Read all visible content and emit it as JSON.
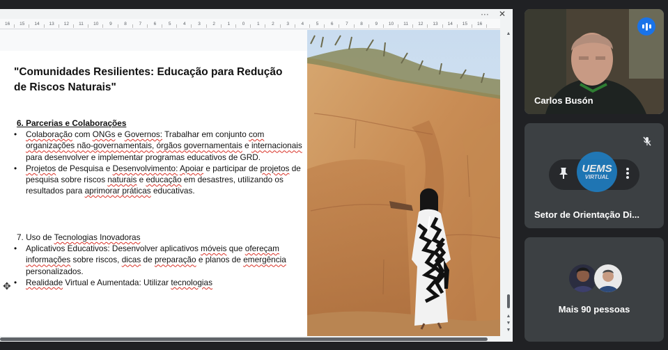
{
  "window": {
    "more_label": "···",
    "close_label": "✕"
  },
  "ruler": {
    "ticks": [
      "16",
      "15",
      "14",
      "13",
      "12",
      "11",
      "10",
      "9",
      "8",
      "7",
      "6",
      "5",
      "4",
      "3",
      "2",
      "1",
      "0",
      "1",
      "2",
      "3",
      "4",
      "5",
      "6",
      "7",
      "8",
      "9",
      "10",
      "11",
      "12",
      "13",
      "14",
      "15",
      "16"
    ]
  },
  "document": {
    "title": "\"Comunidades Resilientes: Educação para Redução de Riscos Naturais\"",
    "section6": {
      "heading": "6. Parcerias e Colaborações",
      "bullets": [
        [
          {
            "t": "Colaboração",
            "sq": true
          },
          {
            "t": " com "
          },
          {
            "t": "ONGs",
            "sq": true
          },
          {
            "t": " e "
          },
          {
            "t": "Governos:",
            "sq": true
          },
          {
            "t": " Trabalhar em conjunto "
          },
          {
            "t": "com organizações não-governamentais,",
            "sq": true
          },
          {
            "t": " "
          },
          {
            "t": "órgãos governamentais",
            "sq": true
          },
          {
            "t": " e "
          },
          {
            "t": "internacionais",
            "sq": true
          },
          {
            "t": " para desenvolver e implementar programas educativos de GRD."
          }
        ],
        [
          {
            "t": "Projetos",
            "sq": true
          },
          {
            "t": " de Pesquisa e "
          },
          {
            "t": "Desenvolvimento:",
            "sq": true
          },
          {
            "t": " "
          },
          {
            "t": "Apoiar",
            "sq": true
          },
          {
            "t": " e participar de "
          },
          {
            "t": "projetos",
            "sq": true
          },
          {
            "t": " de pesquisa sobre riscos "
          },
          {
            "t": "naturais",
            "sq": true
          },
          {
            "t": " e "
          },
          {
            "t": "educação",
            "sq": true
          },
          {
            "t": " em desastres, utilizando os resultados para "
          },
          {
            "t": "aprimorar práticas",
            "sq": true
          },
          {
            "t": " educativas."
          }
        ]
      ]
    },
    "section7": {
      "heading_parts": [
        {
          "t": "7. Uso de "
        },
        {
          "t": "Tecnologias Inovadoras",
          "sq": true
        }
      ],
      "bullets": [
        [
          {
            "t": "Aplicativos Educativos: Desenvolver aplicativos "
          },
          {
            "t": "móveis",
            "sq": true
          },
          {
            "t": " que "
          },
          {
            "t": "ofereçam informações",
            "sq": true
          },
          {
            "t": " sobre riscos, "
          },
          {
            "t": "dicas",
            "sq": true
          },
          {
            "t": " de "
          },
          {
            "t": "preparação",
            "sq": true
          },
          {
            "t": " e planos de "
          },
          {
            "t": "emergência",
            "sq": true
          },
          {
            "t": " personalizados."
          }
        ],
        [
          {
            "t": "Realidade",
            "sq": true
          },
          {
            "t": " Virtual e Aumentada: Utilizar "
          },
          {
            "t": "tecnologias",
            "sq": true
          }
        ]
      ]
    }
  },
  "participants": {
    "speaker": {
      "name": "Carlos Busón",
      "status_icon": "speaking-icon"
    },
    "org": {
      "name": "Setor de Orientação Di...",
      "logo_line1": "UEMS",
      "logo_line2": "VIRTUAL",
      "muted_icon": "mic-off-icon",
      "pin_icon": "pin-icon",
      "more_icon": "more-vert-icon"
    },
    "more": {
      "label": "Mais 90 pessoas"
    }
  },
  "colors": {
    "speaker_border": "#8ab4f8",
    "speaking_badge": "#1a73e8",
    "spellcheck": "#d93025",
    "tile_bg": "#3c4043"
  }
}
